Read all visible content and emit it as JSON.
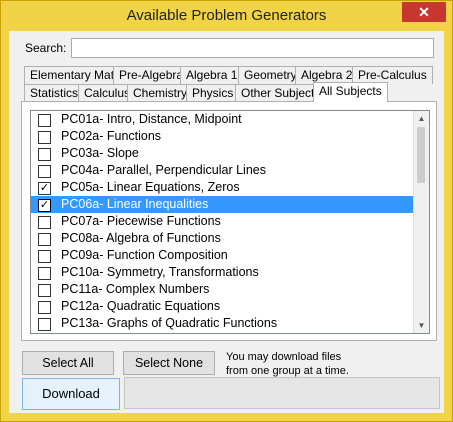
{
  "window": {
    "title": "Available Problem Generators",
    "close_glyph": "✕"
  },
  "search": {
    "label": "Search:",
    "value": "",
    "placeholder": ""
  },
  "tabs_row1": [
    "Elementary Math",
    "Pre-Algebra",
    "Algebra 1",
    "Geometry",
    "Algebra 2",
    "Pre-Calculus"
  ],
  "tabs_row2": [
    "Statistics",
    "Calculus",
    "Chemistry",
    "Physics",
    "Other Subjects",
    "All Subjects"
  ],
  "active_tab": "All Subjects",
  "items": [
    {
      "label": "PC01a- Intro, Distance, Midpoint",
      "checked": false,
      "selected": false
    },
    {
      "label": "PC02a- Functions",
      "checked": false,
      "selected": false
    },
    {
      "label": "PC03a- Slope",
      "checked": false,
      "selected": false
    },
    {
      "label": "PC04a- Parallel, Perpendicular Lines",
      "checked": false,
      "selected": false
    },
    {
      "label": "PC05a- Linear Equations, Zeros",
      "checked": true,
      "selected": false
    },
    {
      "label": "PC06a- Linear Inequalities",
      "checked": true,
      "selected": true
    },
    {
      "label": "PC07a- Piecewise Functions",
      "checked": false,
      "selected": false
    },
    {
      "label": "PC08a- Algebra of Functions",
      "checked": false,
      "selected": false
    },
    {
      "label": "PC09a- Function Composition",
      "checked": false,
      "selected": false
    },
    {
      "label": "PC10a- Symmetry, Transformations",
      "checked": false,
      "selected": false
    },
    {
      "label": "PC11a- Complex Numbers",
      "checked": false,
      "selected": false
    },
    {
      "label": "PC12a- Quadratic Equations",
      "checked": false,
      "selected": false
    },
    {
      "label": "PC13a- Graphs of Quadratic Functions",
      "checked": false,
      "selected": false
    }
  ],
  "check_glyph": "✓",
  "scroll": {
    "up_glyph": "▲",
    "down_glyph": "▼"
  },
  "buttons": {
    "select_all": "Select All",
    "select_none": "Select None",
    "download": "Download"
  },
  "note": {
    "line1": "You may download files",
    "line2": "from one group at a time."
  },
  "colors": {
    "frame": "#f0d347",
    "selection": "#3399ff"
  }
}
